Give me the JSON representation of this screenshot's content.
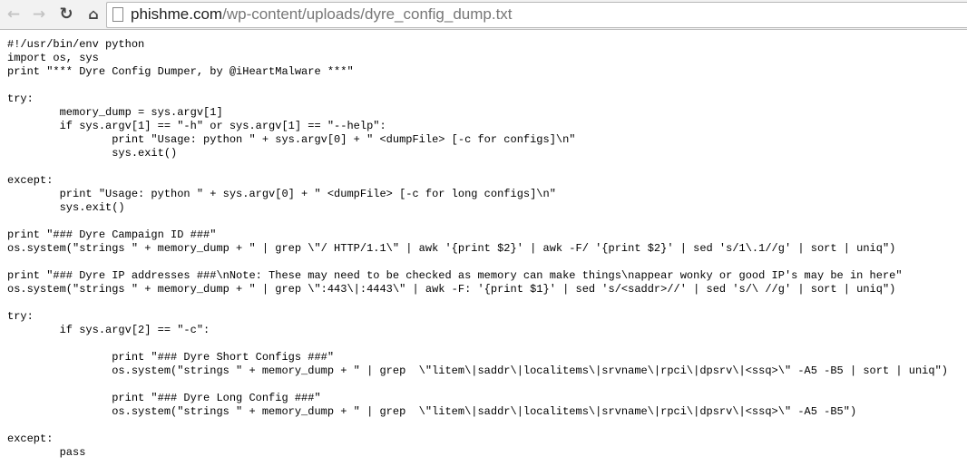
{
  "browser": {
    "url_host": "phishme.com",
    "url_path": "/wp-content/uploads/dyre_config_dump.txt",
    "icons": [
      "back-arrow-icon",
      "forward-arrow-icon",
      "reload-icon",
      "home-icon",
      "page-icon"
    ]
  },
  "document": {
    "lines": [
      "#!/usr/bin/env python",
      "import os, sys",
      "print \"*** Dyre Config Dumper, by @iHeartMalware ***\"",
      "",
      "try:",
      "\tmemory_dump = sys.argv[1]",
      "\tif sys.argv[1] == \"-h\" or sys.argv[1] == \"--help\":",
      "\t\tprint \"Usage: python \" + sys.argv[0] + \" <dumpFile> [-c for configs]\\n\"",
      "\t\tsys.exit()",
      "",
      "except:",
      "\tprint \"Usage: python \" + sys.argv[0] + \" <dumpFile> [-c for long configs]\\n\"",
      "\tsys.exit()",
      "",
      "print \"### Dyre Campaign ID ###\"",
      "os.system(\"strings \" + memory_dump + \" | grep \\\"/ HTTP/1.1\\\" | awk '{print $2}' | awk -F/ '{print $2}' | sed 's/1\\.1//g' | sort | uniq\")",
      "",
      "print \"### Dyre IP addresses ###\\nNote: These may need to be checked as memory can make things\\nappear wonky or good IP's may be in here\"",
      "os.system(\"strings \" + memory_dump + \" | grep \\\":443\\|:4443\\\" | awk -F: '{print $1}' | sed 's/<saddr>//' | sed 's/\\ //g' | sort | uniq\")",
      "",
      "try:",
      "\tif sys.argv[2] == \"-c\":",
      "",
      "\t\tprint \"### Dyre Short Configs ###\"",
      "\t\tos.system(\"strings \" + memory_dump + \" | grep  \\\"litem\\|saddr\\|localitems\\|srvname\\|rpci\\|dpsrv\\|<ssq>\\\" -A5 -B5 | sort | uniq\")",
      "",
      "\t\tprint \"### Dyre Long Config ###\"",
      "\t\tos.system(\"strings \" + memory_dump + \" | grep  \\\"litem\\|saddr\\|localitems\\|srvname\\|rpci\\|dpsrv\\|<ssq>\\\" -A5 -B5\")",
      "",
      "except:",
      "\tpass"
    ]
  }
}
